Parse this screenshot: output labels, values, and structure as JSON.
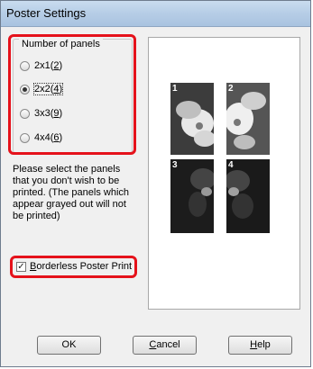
{
  "window": {
    "title": "Poster Settings"
  },
  "panels_group": {
    "legend": "Number of panels",
    "options": [
      {
        "label": "2x1",
        "key": "2",
        "selected": false
      },
      {
        "label": "2x2",
        "key": "4",
        "selected": true
      },
      {
        "label": "3x3",
        "key": "9",
        "selected": false
      },
      {
        "label": "4x4",
        "key": "6",
        "selected": false
      }
    ]
  },
  "instructions": "Please select the panels that you don't wish to be printed. (The panels which appear grayed out will not be printed)",
  "borderless": {
    "label": "Borderless Poster Print",
    "mnemonic": "B",
    "label_rest": "orderless Poster Print",
    "checked": true
  },
  "preview": {
    "panel_numbers": [
      "1",
      "2",
      "3",
      "4"
    ]
  },
  "buttons": {
    "ok": "OK",
    "cancel": {
      "mnemonic": "C",
      "rest": "ancel"
    },
    "help": {
      "mnemonic": "H",
      "rest": "elp"
    }
  },
  "highlight_color": "#e5121b"
}
